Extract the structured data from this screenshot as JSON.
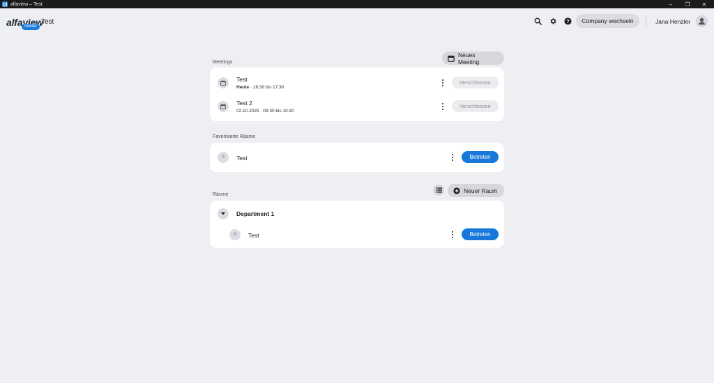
{
  "window": {
    "title": "alfaview – Test"
  },
  "header": {
    "logo_text": "alfaview",
    "logo_badge": "Insider",
    "app_title": "Test",
    "company_button": "Company wechseln",
    "user_name": "Jana Henzler"
  },
  "meetings": {
    "label": "Meetings",
    "new_button": "Neues Meeting",
    "items": [
      {
        "title": "Test",
        "date_bold": "Heute",
        "time": " · 16:30 bis 17:30",
        "action": "Verschlossen"
      },
      {
        "title": "Test 2",
        "date_bold": "",
        "time": "02.10.2025 · 09:30 bis 10:30",
        "action": "Verschlossen"
      }
    ]
  },
  "favorites": {
    "label": "Favorisierte Räume",
    "items": [
      {
        "count": "0",
        "title": "Test",
        "action": "Betreten"
      }
    ]
  },
  "rooms": {
    "label": "Räume",
    "new_button": "Neuer Raum",
    "department": "Department 1",
    "items": [
      {
        "count": "0",
        "title": "Test",
        "action": "Betreten"
      }
    ]
  },
  "colors": {
    "background": "#eeeff3",
    "primary": "#1778d9",
    "titlebar": "#1b1b1b"
  }
}
